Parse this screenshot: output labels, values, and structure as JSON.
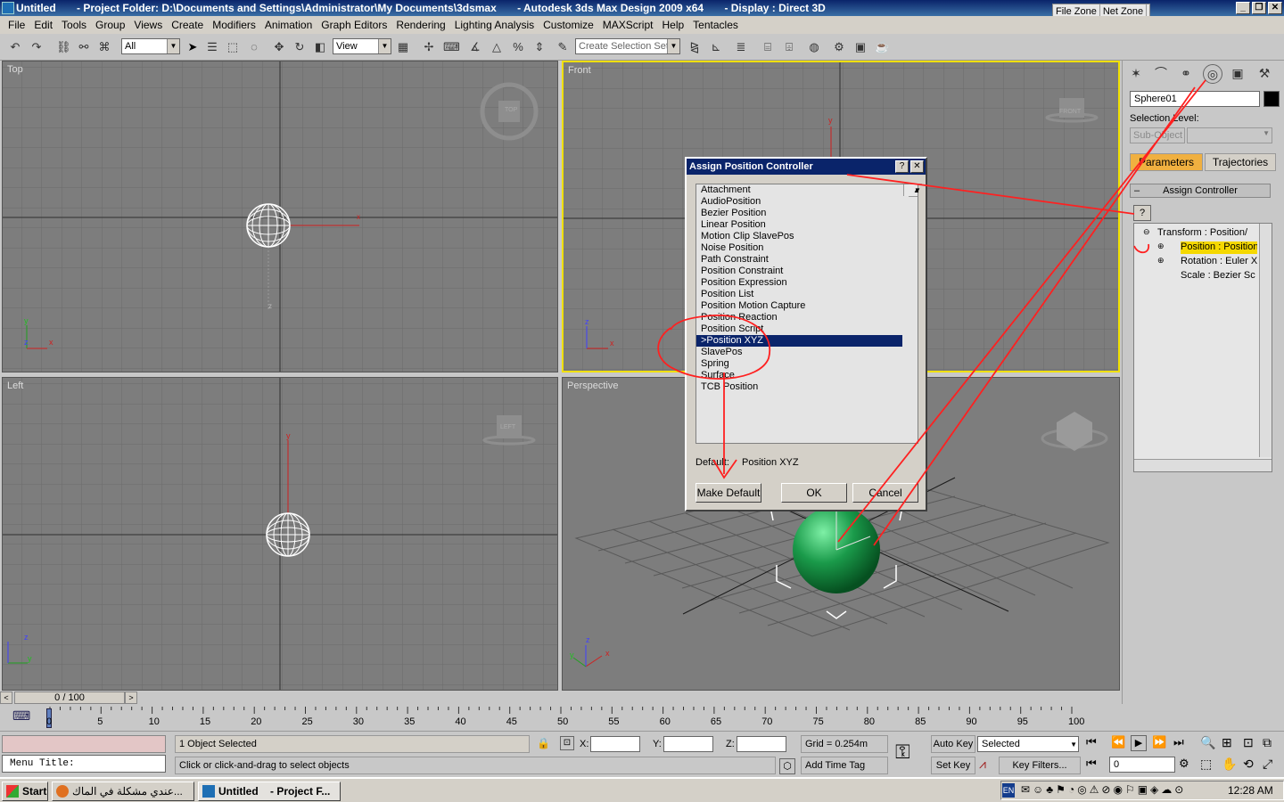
{
  "window": {
    "title": "Untitled",
    "project": "- Project Folder: D:\\Documents and Settings\\Administrator\\My Documents\\3dsmax",
    "app": "- Autodesk 3ds Max Design 2009 x64",
    "display": "- Display : Direct 3D"
  },
  "zones": [
    "File Zone",
    "Net Zone"
  ],
  "menu": [
    "File",
    "Edit",
    "Tools",
    "Group",
    "Views",
    "Create",
    "Modifiers",
    "Animation",
    "Graph Editors",
    "Rendering",
    "Lighting Analysis",
    "Customize",
    "MAXScript",
    "Help",
    "Tentacles"
  ],
  "toolbar": {
    "filter": "All",
    "refcoord": "View",
    "selection_set": "Create Selection Set"
  },
  "viewports": {
    "top": "Top",
    "front": "Front",
    "left": "Left",
    "perspective": "Perspective",
    "cube_top": "TOP",
    "cube_front": "FRONT",
    "cube_left": "LEFT"
  },
  "command_panel": {
    "object_name": "Sphere01",
    "selection_level_label": "Selection Level:",
    "sub_object": "Sub-Object",
    "tab_parameters": "Parameters",
    "tab_trajectories": "Trajectories",
    "rollout": "Assign Controller",
    "rollout_sign": "–",
    "tree": [
      "Transform : Position/",
      "Position : Position",
      "Rotation : Euler X",
      "Scale : Bezier Sc"
    ]
  },
  "dialog": {
    "title": "Assign Position Controller",
    "help_btn": "?",
    "close_btn": "✕",
    "items": [
      "Attachment",
      "AudioPosition",
      "Bezier Position",
      "Linear Position",
      "Motion Clip SlavePos",
      "Noise Position",
      "Path Constraint",
      "Position Constraint",
      "Position Expression",
      "Position List",
      "Position Motion Capture",
      "Position Reaction",
      "Position Script",
      ">Position XYZ",
      "SlavePos",
      "Spring",
      "Surface",
      "TCB Position"
    ],
    "selected_index": 13,
    "default_label": "Default:",
    "default_value": "Position XYZ",
    "make_default": "Make Default",
    "ok": "OK",
    "cancel": "Cancel"
  },
  "timeline": {
    "slider": "0 / 100",
    "ticks": [
      0,
      5,
      10,
      15,
      20,
      25,
      30,
      35,
      40,
      45,
      50,
      55,
      60,
      65,
      70,
      75,
      80,
      85,
      90,
      95,
      100
    ]
  },
  "status": {
    "menu_title": "Menu Title:",
    "selected": "1 Object Selected",
    "prompt": "Click or click-and-drag to select objects",
    "x_label": "X:",
    "y_label": "Y:",
    "z_label": "Z:",
    "grid": "Grid = 0.254m",
    "add_time_tag": "Add Time Tag",
    "auto_key": "Auto Key",
    "set_key": "Set Key",
    "key_mode": "Selected",
    "key_filters": "Key Filters...",
    "frame": "0"
  },
  "taskbar": {
    "start": "Start",
    "task1": "عندي مشكلة في الماك...",
    "task2_a": "Untitled",
    "task2_b": "- Project F...",
    "lang": "EN",
    "clock": "12:28 AM"
  },
  "axis": {
    "x": "x",
    "y": "y",
    "z": "z"
  },
  "colors": {
    "selection": "#0a246a",
    "annotation": "#ff2020",
    "active_viewport": "#f0e000",
    "sphere": "#1a9a4a"
  }
}
